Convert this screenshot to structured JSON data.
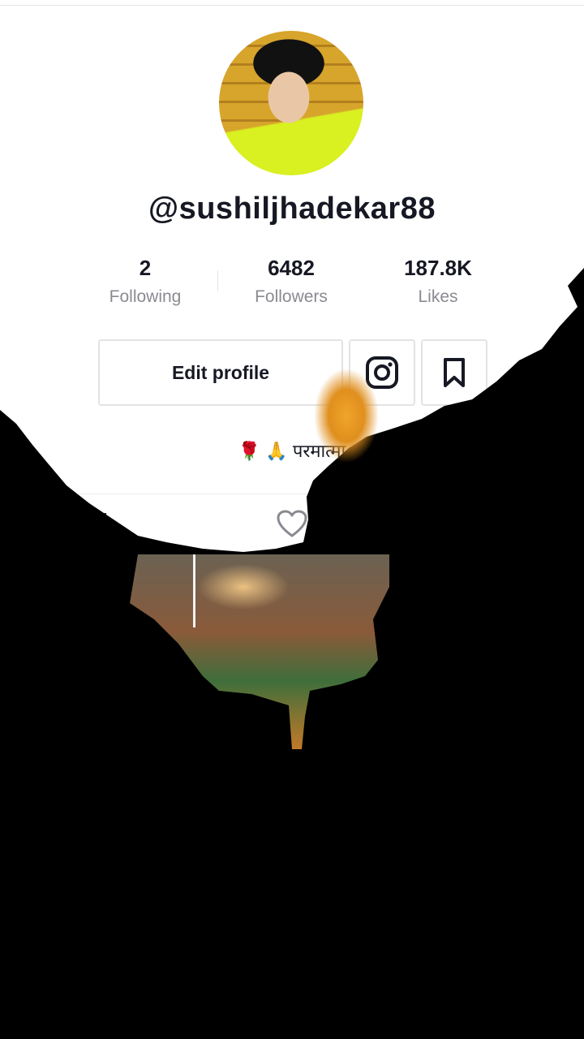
{
  "profile": {
    "username": "@sushiljhadekar88",
    "avatar_icon": "profile-photo",
    "stats": [
      {
        "value": "2",
        "label": "Following"
      },
      {
        "value": "6482",
        "label": "Followers"
      },
      {
        "value": "187.8K",
        "label": "Likes"
      }
    ],
    "edit_profile_label": "Edit profile",
    "bio_text": "परमात्मा"
  },
  "icons": {
    "instagram": "instagram-icon",
    "bookmark": "bookmark-icon",
    "bio_flower": "🌹",
    "bio_pray": "🙏",
    "grid_tab": "grid-icon",
    "liked_tab": "heart-icon"
  },
  "colors": {
    "text_primary": "#161823",
    "text_secondary": "#8a8b91",
    "border": "#e3e3e4",
    "background_overlay": "#000000",
    "accent_orange": "#e08f1e"
  }
}
